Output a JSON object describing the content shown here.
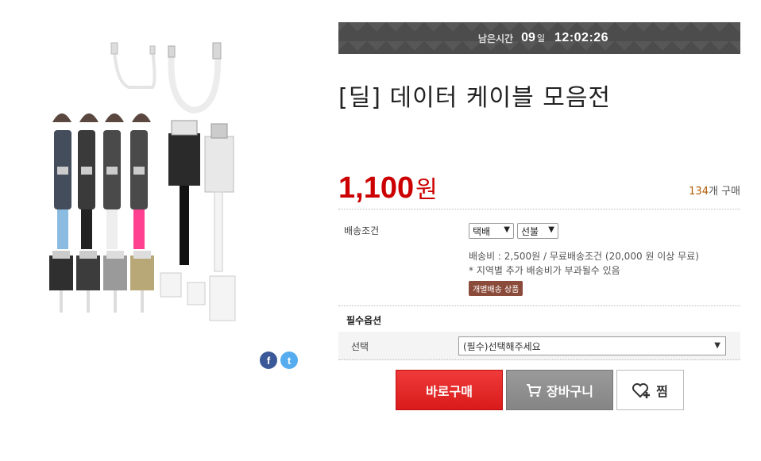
{
  "product": {
    "title": "[딜] 데이터 케이블 모음전",
    "price_number": "1,100",
    "price_unit": "원",
    "purchase_count": "134",
    "purchase_suffix": "개 구매"
  },
  "timer": {
    "label": "남은시간",
    "days": "09",
    "days_unit": "일",
    "time": "12:02:26"
  },
  "shipping": {
    "label": "배송조건",
    "method": "택배",
    "payment": "선불",
    "fee_text": "배송비 : 2,500원 / 무료배송조건 (20,000 원 이상 무료)",
    "note": "* 지역별 추가 배송비가 부과될수 있음",
    "badge": "개별배송 상품"
  },
  "options": {
    "title": "필수옵션",
    "label": "선택",
    "placeholder": "(필수)선택해주세요"
  },
  "share": {
    "facebook_icon": "f",
    "twitter_icon": "t"
  },
  "actions": {
    "buy": "바로구매",
    "cart": "장바구니",
    "wish": "찜"
  },
  "colors": {
    "price": "#cc0000",
    "buy_button": "#e02828",
    "cart_button": "#8e8e8e",
    "badge": "#8a4b3a"
  }
}
